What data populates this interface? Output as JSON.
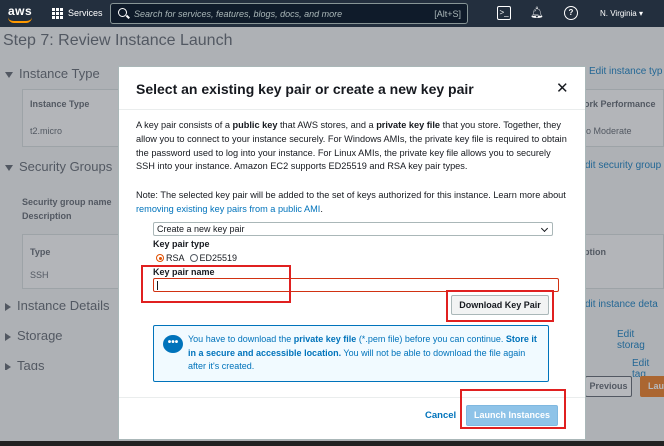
{
  "topnav": {
    "logo": "aws",
    "services": "Services",
    "search_placeholder": "Search for services, features, blogs, docs, and more",
    "search_shortcut": "[Alt+S]",
    "region": "N. Virginia",
    "icons": [
      "cloudshell-icon",
      "bell-icon",
      "help-icon"
    ]
  },
  "background": {
    "step_title": "Step 7: Review Instance Launch",
    "sections": {
      "instance_type": "Instance Type",
      "security_groups": "Security Groups",
      "instance_details": "Instance Details",
      "storage": "Storage",
      "tags": "Tags"
    },
    "edit_links": {
      "instance_type": "Edit instance typ",
      "security_groups": "dit security group",
      "instance_details": "dit instance deta",
      "storage": "Edit storag",
      "tags": "Edit tag"
    },
    "instance_table": {
      "header_left": "Instance Type",
      "header_right": "ork Performance",
      "cell_left": "t2.micro",
      "cell_right": "o Moderate"
    },
    "sg_labels": [
      "Security group name",
      "Description"
    ],
    "rules_table": {
      "header_left": "Type",
      "header_right": "ption",
      "cell_left": "SSH"
    },
    "previous": "Previous",
    "launch": "Lau"
  },
  "modal": {
    "title": "Select an existing key pair or create a new key pair",
    "desc_parts": [
      "A key pair consists of a ",
      "public key",
      " that AWS stores, and a ",
      "private key file",
      " that you store. Together, they allow you to connect to your instance securely. For Windows AMIs, the private key file is required to obtain the password used to log into your instance. For Linux AMIs, the private key file allows you to securely SSH into your instance. Amazon EC2 supports ED25519 and RSA key pair types."
    ],
    "note_text": "Note: The selected key pair will be added to the set of keys authorized for this instance. Learn more about ",
    "note_link": "removing existing key pairs from a public AMI",
    "note_end": ".",
    "select_value": "Create a new key pair",
    "key_type_label": "Key pair type",
    "key_types": [
      "RSA",
      "ED25519"
    ],
    "key_type_selected": "RSA",
    "key_name_label": "Key pair name",
    "key_name_value": "",
    "download_button": "Download Key Pair",
    "info_parts": [
      "You have to download the ",
      "private key file",
      " (*.pem file) before you can continue. ",
      "Store it in a secure and accessible location.",
      " You will not be able to download the file again after it's created."
    ],
    "cancel": "Cancel",
    "launch_button": "Launch Instances",
    "colors": {
      "link": "#0073bb",
      "highlight_box": "#e02020",
      "error_border": "#d13212"
    }
  }
}
